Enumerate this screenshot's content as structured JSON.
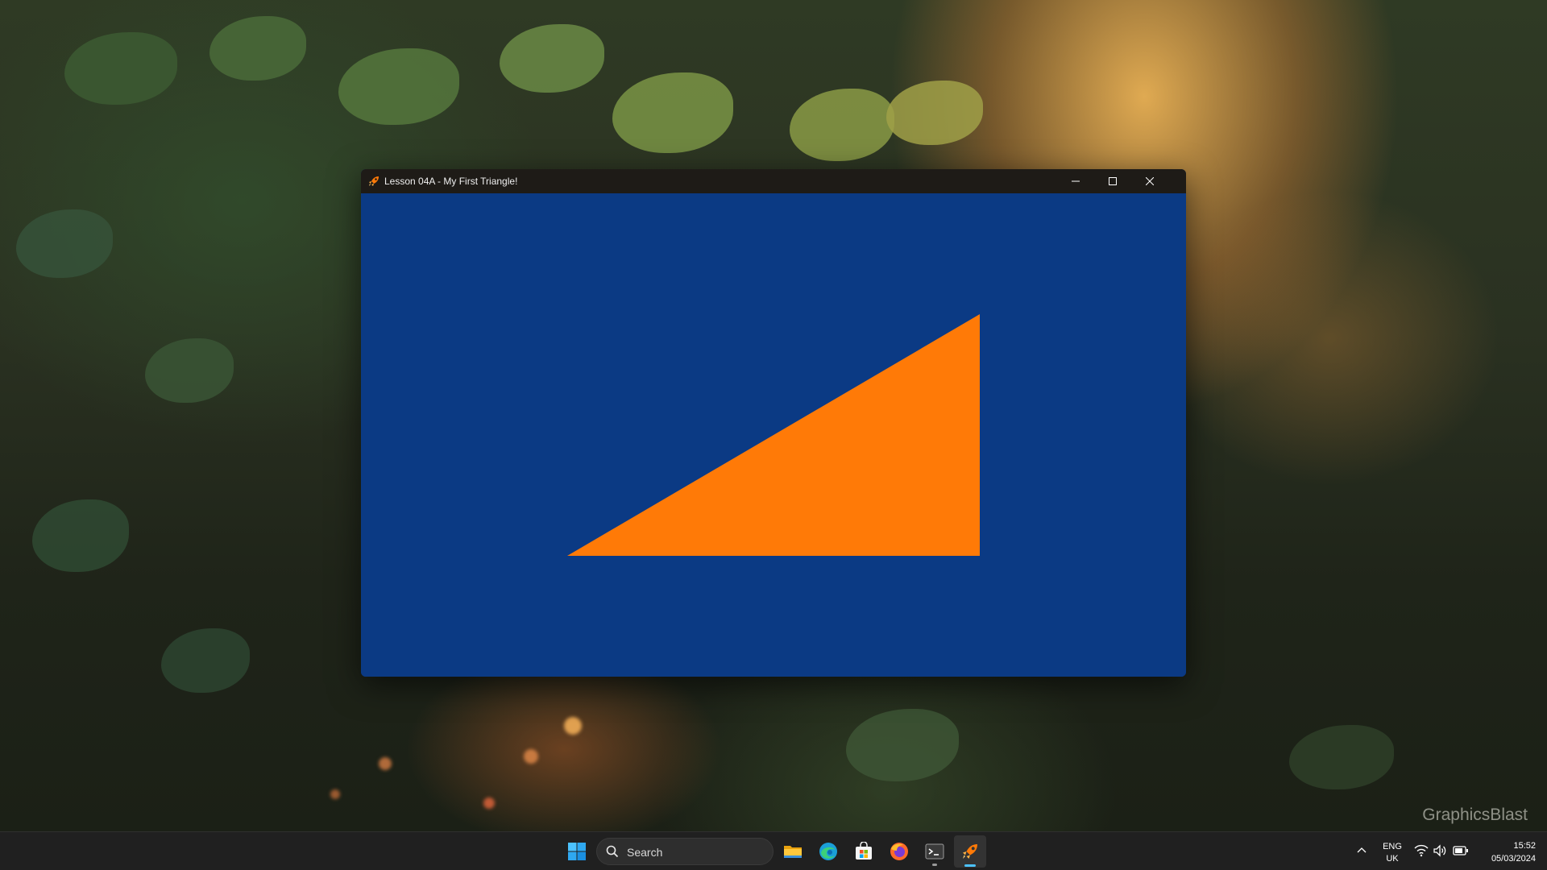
{
  "window": {
    "title": "Lesson 04A - My First Triangle!",
    "clear_color": "#0b3a84",
    "triangle_color": "#ff7a07",
    "icon": "rocket-icon"
  },
  "caption_buttons": {
    "minimize": "minimize-icon",
    "maximize": "maximize-icon",
    "close": "close-icon"
  },
  "taskbar": {
    "search_placeholder": "Search",
    "pinned_apps": [
      "windows-start-icon",
      "file-explorer-icon",
      "edge-icon",
      "microsoft-store-icon",
      "firefox-icon",
      "terminal-icon",
      "rocket-icon"
    ],
    "language": {
      "line1": "ENG",
      "line2": "UK"
    },
    "clock": {
      "time": "15:52",
      "date": "05/03/2024"
    },
    "accent_color": "#4cc2ff"
  },
  "desktop": {
    "watermark": "GraphicsBlast"
  }
}
